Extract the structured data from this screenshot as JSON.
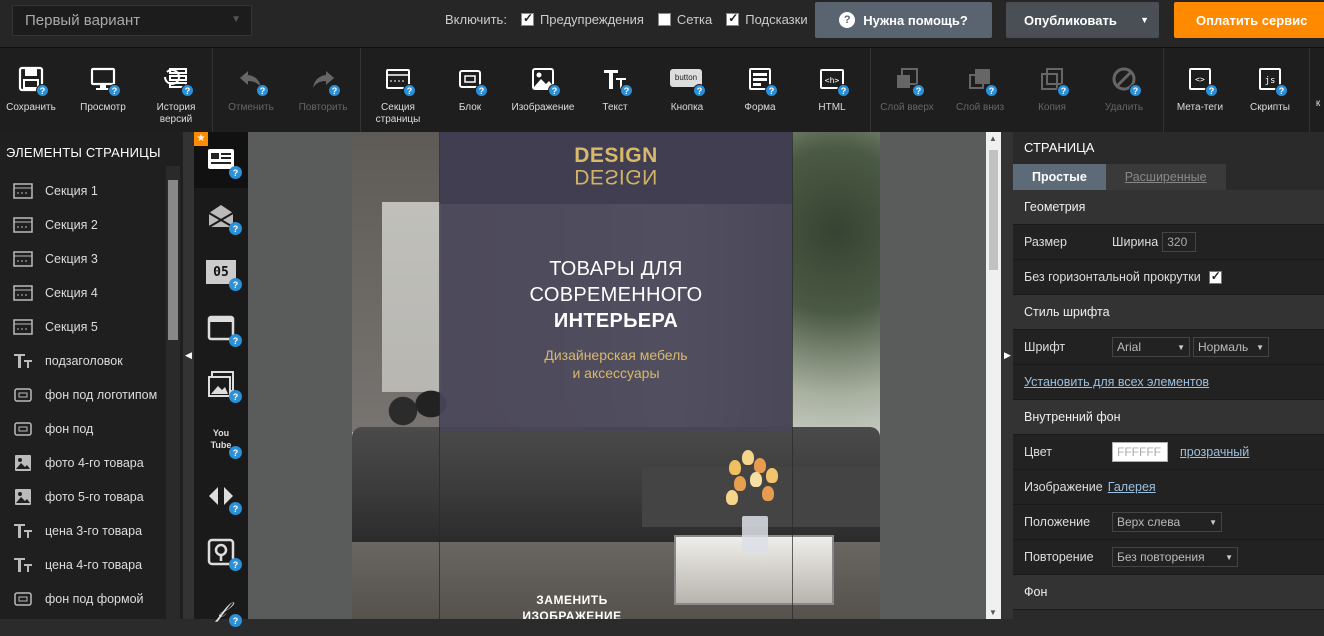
{
  "topbar": {
    "variant": "Первый вариант",
    "toggles_label": "Включить:",
    "toggles": [
      {
        "label": "Предупреждения",
        "checked": true
      },
      {
        "label": "Сетка",
        "checked": false
      },
      {
        "label": "Подсказки",
        "checked": true
      }
    ],
    "help": "Нужна помощь?",
    "publish": "Опубликовать",
    "pay": "Оплатить сервис"
  },
  "toolbar": {
    "save": "Сохранить",
    "preview": "Просмотр",
    "history": "История версий",
    "undo": "Отменить",
    "redo": "Повторить",
    "section": "Секция страницы",
    "block": "Блок",
    "image": "Изображение",
    "text": "Текст",
    "button": "Кнопка",
    "button_icon_text": "button",
    "form": "Форма",
    "html": "HTML",
    "layer_up": "Слой вверх",
    "layer_down": "Слой вниз",
    "copy": "Копия",
    "delete": "Удалить",
    "meta": "Мета-теги",
    "scripts": "Скрипты",
    "overflow": "к"
  },
  "left": {
    "title": "ЭЛЕМЕНТЫ СТРАНИЦЫ",
    "items": [
      {
        "icon": "section",
        "label": "Секция 1"
      },
      {
        "icon": "section",
        "label": "Секция 2"
      },
      {
        "icon": "section",
        "label": "Секция 3"
      },
      {
        "icon": "section",
        "label": "Секция 4"
      },
      {
        "icon": "section",
        "label": "Секция 5"
      },
      {
        "icon": "text",
        "label": "подзаголовок"
      },
      {
        "icon": "block",
        "label": "фон под логотипом"
      },
      {
        "icon": "block",
        "label": "фон под"
      },
      {
        "icon": "image",
        "label": "фото 4-го товара"
      },
      {
        "icon": "image",
        "label": "фото 5-го товара"
      },
      {
        "icon": "text",
        "label": "цена 3-го товара"
      },
      {
        "icon": "text",
        "label": "цена 4-го товара"
      },
      {
        "icon": "block",
        "label": "фон под формой"
      }
    ]
  },
  "blocks": {
    "timer_text": "05",
    "youtube_text": "You Tube"
  },
  "page": {
    "logo_top": "DESIGN",
    "logo_bottom": "DESIGN",
    "title_line1": "ТОВАРЫ ДЛЯ",
    "title_line2": "СОВРЕМЕННОГО",
    "title_line3": "ИНТЕРЬЕРА",
    "sub_line1": "Дизайнерская мебель",
    "sub_line2": "и аксессуары",
    "replace_line1": "ЗАМЕНИТЬ",
    "replace_line2": "ИЗОБРАЖЕНИЕ"
  },
  "right": {
    "title": "СТРАНИЦА",
    "tab_simple": "Простые",
    "tab_advanced": "Расширенные",
    "geometry": "Геометрия",
    "size": "Размер",
    "width_label": "Ширина",
    "width_value": "320",
    "no_hscroll": "Без горизонтальной прокрутки",
    "font_style": "Стиль шрифта",
    "font": "Шрифт",
    "font_family": "Arial",
    "font_weight": "Нормаль",
    "apply_all": "Установить для всех элементов",
    "inner_bg": "Внутренний фон",
    "color": "Цвет",
    "color_value": "FFFFFF",
    "transparent": "прозрачный",
    "image": "Изображение",
    "gallery": "Галерея",
    "position": "Положение",
    "position_value": "Верх слева",
    "repeat": "Повторение",
    "repeat_value": "Без повторения",
    "bg": "Фон"
  },
  "colors": {
    "accent_orange": "#ff8a00",
    "help_button": "#5a6470",
    "badge_blue": "#2a90d8",
    "logo_gold": "#d9b96a",
    "hero_overlay": "#484558"
  }
}
